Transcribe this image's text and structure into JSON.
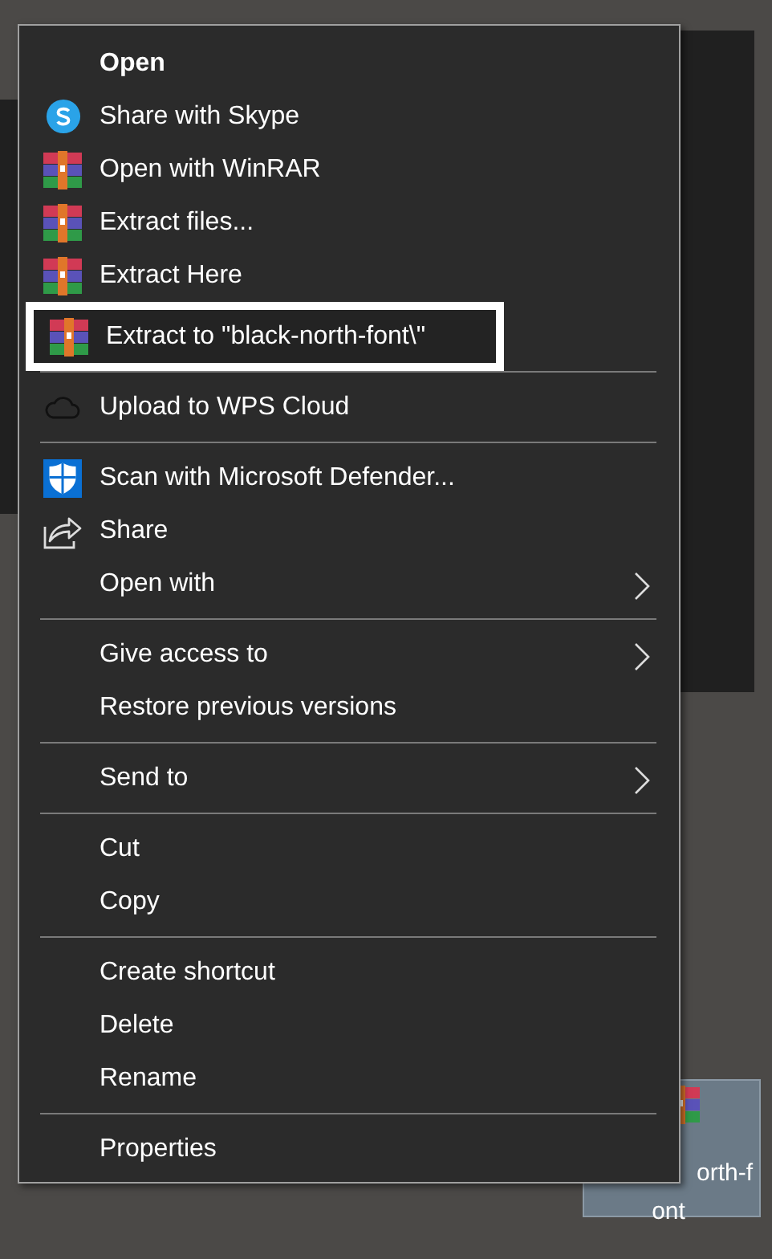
{
  "desktop_file": {
    "label_lines": [
      "orth-f",
      "ont"
    ],
    "selected": true
  },
  "context_menu": {
    "groups": [
      [
        {
          "label": "Open",
          "kind": "plain",
          "bold": true,
          "selected": false,
          "submenu": false
        },
        {
          "label": "Share with Skype",
          "kind": "skype",
          "bold": false,
          "selected": false,
          "submenu": false
        },
        {
          "label": "Open with WinRAR",
          "kind": "winrar",
          "bold": false,
          "selected": false,
          "submenu": false
        },
        {
          "label": "Extract files...",
          "kind": "winrar",
          "bold": false,
          "selected": false,
          "submenu": false
        },
        {
          "label": "Extract Here",
          "kind": "winrar",
          "bold": false,
          "selected": false,
          "submenu": false
        },
        {
          "label": "Extract to \"black-north-font\\\"",
          "kind": "winrar",
          "bold": false,
          "selected": true,
          "submenu": false
        }
      ],
      [
        {
          "label": "Upload to WPS Cloud",
          "kind": "cloud",
          "bold": false,
          "selected": false,
          "submenu": false
        }
      ],
      [
        {
          "label": "Scan with Microsoft Defender...",
          "kind": "defender",
          "bold": false,
          "selected": false,
          "submenu": false
        },
        {
          "label": "Share",
          "kind": "share",
          "bold": false,
          "selected": false,
          "submenu": false
        },
        {
          "label": "Open with",
          "kind": "plain",
          "bold": false,
          "selected": false,
          "submenu": true
        }
      ],
      [
        {
          "label": "Give access to",
          "kind": "plain",
          "bold": false,
          "selected": false,
          "submenu": true
        },
        {
          "label": "Restore previous versions",
          "kind": "plain",
          "bold": false,
          "selected": false,
          "submenu": false
        }
      ],
      [
        {
          "label": "Send to",
          "kind": "plain",
          "bold": false,
          "selected": false,
          "submenu": true
        }
      ],
      [
        {
          "label": "Cut",
          "kind": "plain",
          "bold": false,
          "selected": false,
          "submenu": false
        },
        {
          "label": "Copy",
          "kind": "plain",
          "bold": false,
          "selected": false,
          "submenu": false
        }
      ],
      [
        {
          "label": "Create shortcut",
          "kind": "plain",
          "bold": false,
          "selected": false,
          "submenu": false
        },
        {
          "label": "Delete",
          "kind": "plain",
          "bold": false,
          "selected": false,
          "submenu": false
        },
        {
          "label": "Rename",
          "kind": "plain",
          "bold": false,
          "selected": false,
          "submenu": false
        }
      ],
      [
        {
          "label": "Properties",
          "kind": "plain",
          "bold": false,
          "selected": false,
          "submenu": false
        }
      ]
    ]
  }
}
